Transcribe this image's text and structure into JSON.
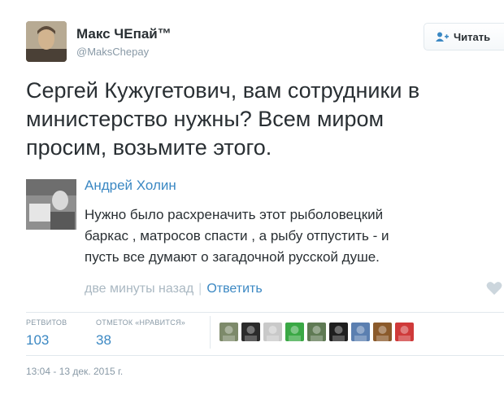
{
  "author": {
    "name": "Макс ЧЕпай™",
    "handle": "@MaksChepay"
  },
  "follow_button": {
    "label": "Читать",
    "icon": "user-plus-icon"
  },
  "tweet": {
    "lines": [
      "Сергей Кужугетович, вам сотрудники в",
      "министерство нужны? Всем миром",
      "просим, возьмите этого."
    ]
  },
  "quoted": {
    "author": "Андрей Холин",
    "lines": [
      "Нужно было расхреначить этот рыболовецкий",
      "баркас , матросов спасти , а рыбу отпустить - и",
      "пусть все думают о загадочной русской душе."
    ],
    "time": "две минуты назад",
    "separator": "|",
    "reply_label": "Ответить",
    "like_icon": "heart-icon"
  },
  "stats": {
    "retweets_label": "РЕТВИТОВ",
    "retweets": "103",
    "likes_label": "ОТМЕТОК «НРАВИТСЯ»",
    "likes": "38"
  },
  "likers": [
    {
      "icon": "liker-avatar-icon",
      "color": "#7d8a6a"
    },
    {
      "icon": "liker-avatar-icon",
      "color": "#2b2b2b"
    },
    {
      "icon": "liker-avatar-icon",
      "color": "#c9c9c9"
    },
    {
      "icon": "liker-avatar-icon",
      "color": "#3aa845"
    },
    {
      "icon": "liker-avatar-icon",
      "color": "#5f7a54"
    },
    {
      "icon": "liker-avatar-icon",
      "color": "#1f1f1f"
    },
    {
      "icon": "liker-avatar-icon",
      "color": "#5b7fb0"
    },
    {
      "icon": "liker-avatar-icon",
      "color": "#8b5a2b"
    },
    {
      "icon": "liker-avatar-icon",
      "color": "#cf3a3a"
    }
  ],
  "timestamp": "13:04 - 13 дек. 2015 г.",
  "colors": {
    "link": "#3b88c3",
    "muted": "#8899a6",
    "text": "#292f33",
    "border": "#e1e8ed"
  }
}
